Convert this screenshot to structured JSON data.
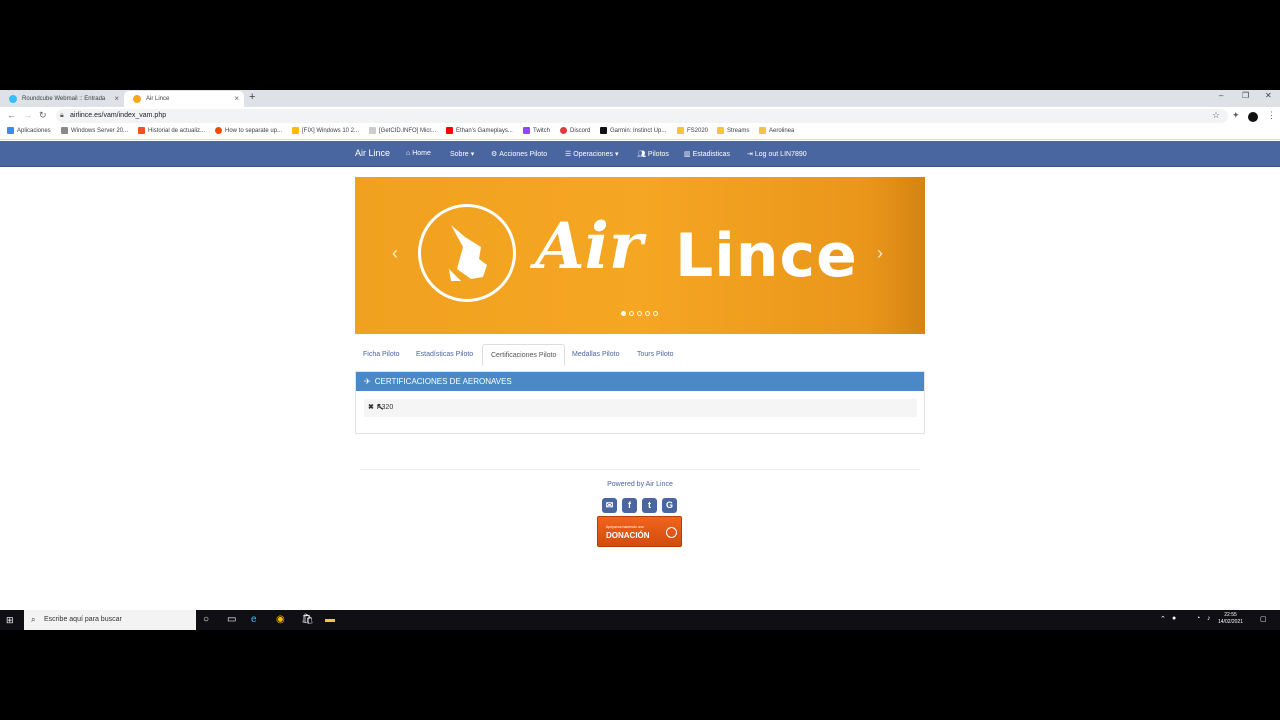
{
  "browser": {
    "tabs": [
      {
        "title": "Roundcube Webmail :: Entrada"
      },
      {
        "title": "Air Lince"
      }
    ],
    "url": "airlince.es/vam/index_vam.php",
    "bookmarks": [
      "Aplicaciones",
      "Windows Server 20...",
      "Historial de actualiz...",
      "How to separate up...",
      "[FIX] Windows 10 2...",
      "[GetCID.INFO] Micr...",
      "Ethan's Gameplays...",
      "Twitch",
      "Discord",
      "Garmin: Instinct Up...",
      "FS2020",
      "Streams",
      "Aerolinea"
    ]
  },
  "nav": {
    "brand": "Air Lince",
    "items": [
      "Home",
      "Sobre",
      "Acciones Piloto",
      "Operaciones",
      "Pilotos",
      "Estadisticas",
      "Log out LIN7890"
    ]
  },
  "banner": {
    "air": "Air",
    "lince": "Lince"
  },
  "profile_tabs": [
    "Ficha Piloto",
    "Estadísticas Piloto",
    "Certificaciones Piloto",
    "Medallas Piloto",
    "Tours Piloto"
  ],
  "panel": {
    "title": "CERTIFICACIONES DE AERONAVES",
    "row": "A320"
  },
  "footer": {
    "powered": "Powered by Air Lince",
    "donate_small": "Apóyanos haciendo una",
    "donate_big": "DONACIÓN"
  },
  "taskbar": {
    "search": "Escribe aquí para buscar",
    "time": "22:55",
    "date": "14/02/2021"
  },
  "colors": {
    "navbar": "#4a66a0",
    "panel_head": "#4a88c7",
    "banner": "#f5a623",
    "donate": "#e85a15"
  }
}
